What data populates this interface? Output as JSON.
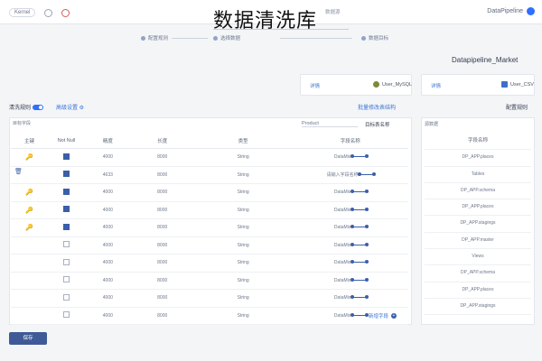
{
  "overlay_title": "数据清洗库",
  "topbar": {
    "brand": "DataPipeline",
    "left_tools": [
      "Kernel",
      "⚙",
      "❤"
    ],
    "tab_hint": "数据源"
  },
  "steps": [
    {
      "label": "配置规则"
    },
    {
      "label": "选择数据"
    },
    {
      "label": "数据目标"
    }
  ],
  "market": "Datapipeline_Market",
  "cards": {
    "left": {
      "name": "User_MySQL",
      "link": "详情"
    },
    "right": {
      "name": "User_CSV",
      "link": "详情"
    }
  },
  "section": {
    "rules_title": "配置规则",
    "sync_toggle_label": "批量修改表结构",
    "adv_label": "高级设置",
    "enable_label": "清洗规则"
  },
  "target_table": {
    "label": "目标表名称",
    "value": "Product"
  },
  "row_header": "目标字段",
  "columns": [
    "字段名称",
    "类型",
    "长度",
    "精度",
    "Not Null",
    "主键"
  ],
  "rows": [
    {
      "name": "DataMix",
      "type": "String",
      "len": "8000",
      "prec": "4000",
      "notnull": true,
      "pk": true
    },
    {
      "name": "请输入字段名称",
      "type": "String",
      "len": "8000",
      "prec": "4633",
      "notnull": true,
      "pk": false,
      "editing": true
    },
    {
      "name": "DataMix",
      "type": "String",
      "len": "8000",
      "prec": "4000",
      "notnull": true,
      "pk": true
    },
    {
      "name": "DataMix",
      "type": "String",
      "len": "8000",
      "prec": "4000",
      "notnull": true,
      "pk": true
    },
    {
      "name": "DataMix",
      "type": "String",
      "len": "8000",
      "prec": "4000",
      "notnull": true,
      "pk": true
    },
    {
      "name": "DataMix",
      "type": "String",
      "len": "8000",
      "prec": "4000",
      "notnull": false,
      "pk": false
    },
    {
      "name": "DataMix",
      "type": "String",
      "len": "8000",
      "prec": "4000",
      "notnull": false,
      "pk": false
    },
    {
      "name": "DataMix",
      "type": "String",
      "len": "8000",
      "prec": "4000",
      "notnull": false,
      "pk": false
    },
    {
      "name": "DataMix",
      "type": "String",
      "len": "8000",
      "prec": "4000",
      "notnull": false,
      "pk": false
    },
    {
      "name": "DataMix",
      "type": "String",
      "len": "8000",
      "prec": "4000",
      "notnull": false,
      "pk": false
    }
  ],
  "source_header": "字段名称",
  "source_fields": [
    "DP_APP.places",
    "Tables",
    "DP_APP.schema",
    "DP_APP.places",
    "DP_APP.stagings",
    "DP_APP.master",
    "Views",
    "DP_APP.schema",
    "DP_APP.places",
    "DP_APP.stagings"
  ],
  "source_box_label": "源数据",
  "add_field": "新增字段",
  "confirm": "保存",
  "colors": {
    "accent": "#3b5fa8",
    "key": "#e5a224",
    "brand": "#2f6fff"
  }
}
